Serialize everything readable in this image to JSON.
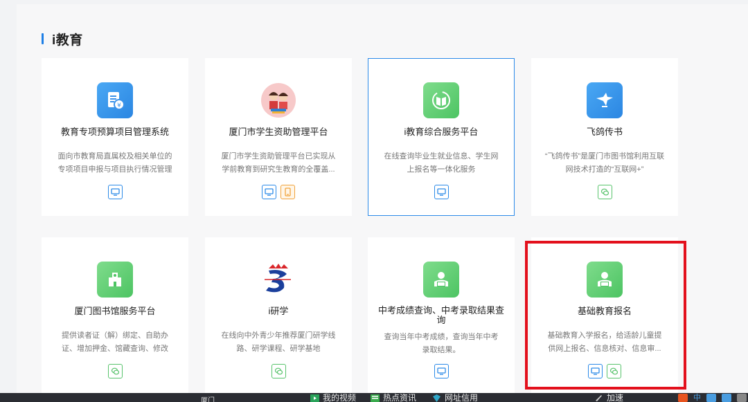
{
  "section": {
    "title": "i教育"
  },
  "cards": [
    {
      "name": "教育专项预算项目管理系统",
      "desc": "面向市教育局直属校及相关单位的专项项目申报与项目执行情况管理",
      "icon": "budget-document-icon",
      "platforms": [
        "pc"
      ]
    },
    {
      "name": "厦门市学生资助管理平台",
      "desc": "厦门市学生资助管理平台已实现从学前教育到研究生教育的全覆盖...",
      "icon": "students-with-books-icon",
      "platforms": [
        "pc",
        "mobile"
      ]
    },
    {
      "name": "i教育综合服务平台",
      "desc": "在线查询毕业生就业信息、学生网上报名等一体化服务",
      "icon": "open-book-icon",
      "platforms": [
        "pc"
      ]
    },
    {
      "name": "飞鸽传书",
      "desc": "“飞鸽传书”是厦门市图书馆利用互联网技术打造的“互联网+”",
      "icon": "pigeon-icon",
      "platforms": [
        "wechat"
      ]
    },
    {
      "name": "厦门图书馆服务平台",
      "desc": "提供读者证（解）绑定、自助办证、增加押金、馆藏查询、修改",
      "icon": "library-building-icon",
      "platforms": [
        "wechat"
      ]
    },
    {
      "name": "i研学",
      "desc": "在线向中外青少年推荐厦门研学线路、研学课程、研学基地",
      "icon": "i-research-logo-icon",
      "platforms": [
        "wechat"
      ]
    },
    {
      "name": "中考成绩查询、中考录取结果查询",
      "desc": "查询当年中考成绩，查询当年中考录取结果。",
      "icon": "reader-person-icon",
      "platforms": [
        "pc"
      ]
    },
    {
      "name": "基础教育报名",
      "desc": "基础教育入学报名，给适龄儿童提供网上报名、信息核对、信息审...",
      "icon": "reader-person-icon",
      "platforms": [
        "pc",
        "wechat"
      ]
    }
  ],
  "taskbar": {
    "left_text": "厦门",
    "items": [
      {
        "label": "我的视频",
        "icon": "play-icon"
      },
      {
        "label": "热点资讯",
        "icon": "news-icon"
      },
      {
        "label": "网址信用",
        "icon": "shield-icon"
      },
      {
        "label": "加速",
        "icon": "rocket-icon"
      }
    ],
    "ime": "中"
  },
  "colors": {
    "accent": "#2b8ae8",
    "green": "#4dc463",
    "highlight": "#e3101c"
  }
}
